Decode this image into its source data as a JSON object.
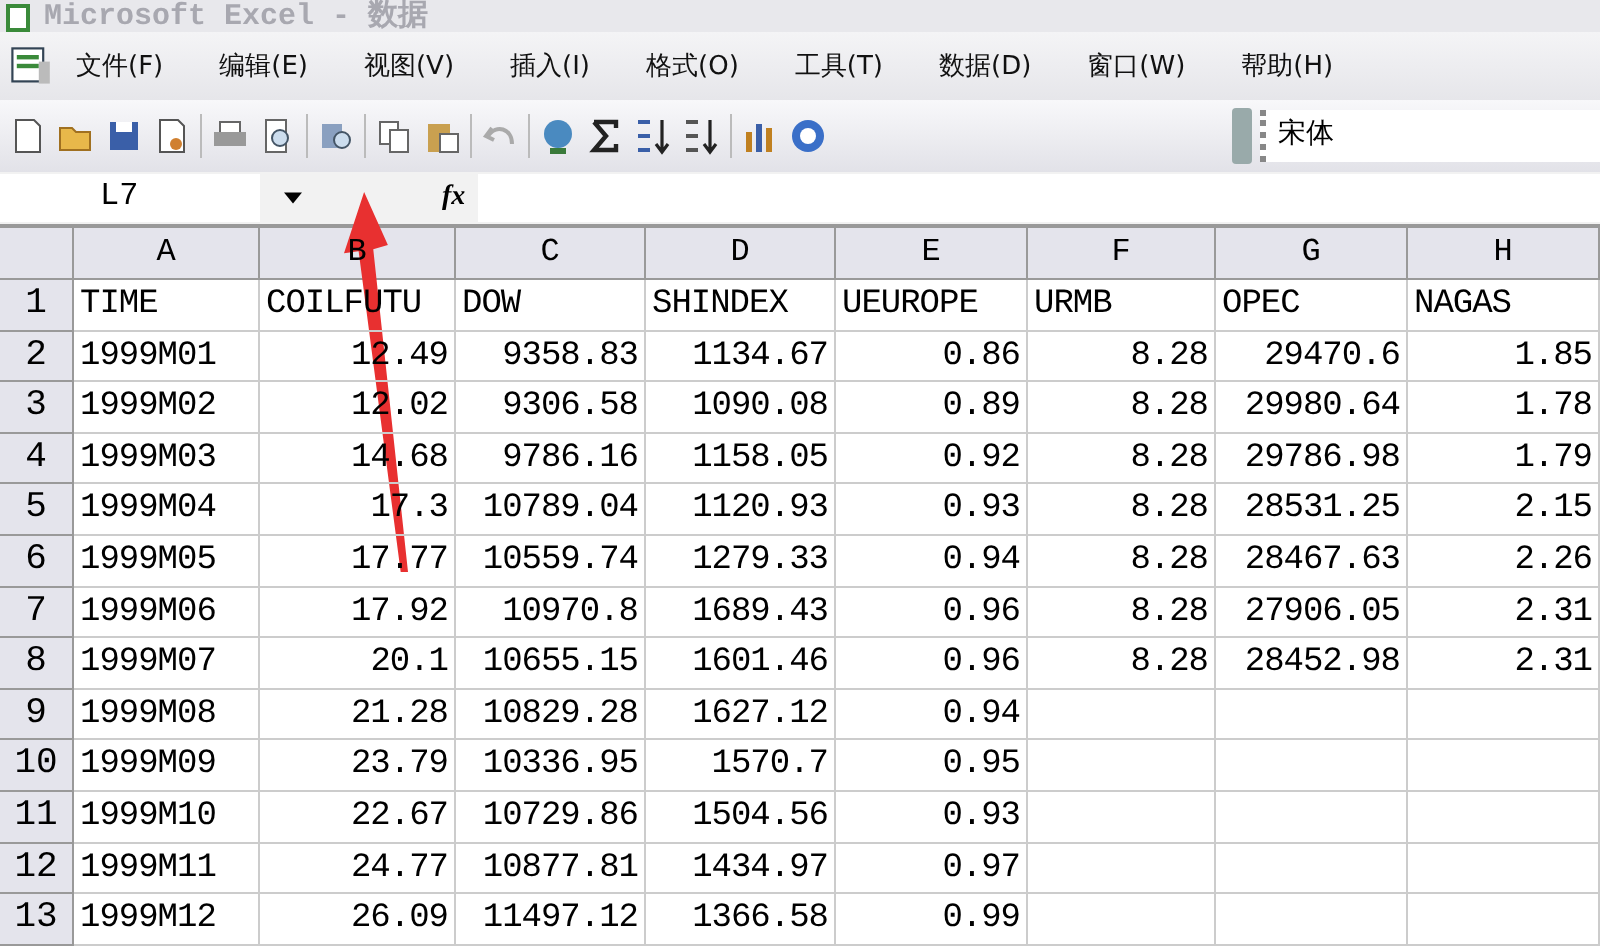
{
  "window": {
    "title": "Microsoft Excel - 数据"
  },
  "menu": [
    "文件(F)",
    "编辑(E)",
    "视图(V)",
    "插入(I)",
    "格式(O)",
    "工具(T)",
    "数据(D)",
    "窗口(W)",
    "帮助(H)"
  ],
  "toolbar": {
    "font": "宋体"
  },
  "formula_bar": {
    "name_box": "L7",
    "function_label": "fx"
  },
  "sheet": {
    "columns": [
      "A",
      "B",
      "C",
      "D",
      "E",
      "F",
      "G",
      "H"
    ],
    "rows": [
      {
        "number": "1",
        "cells": [
          "TIME",
          "COILFUTU",
          "DOW",
          "SHINDEX",
          "UEUROPE",
          "URMB",
          "OPEC",
          "NAGAS"
        ]
      },
      {
        "number": "2",
        "cells": [
          "1999M01",
          "12.49",
          "9358.83",
          "1134.67",
          "0.86",
          "8.28",
          "29470.6",
          "1.85"
        ]
      },
      {
        "number": "3",
        "cells": [
          "1999M02",
          "12.02",
          "9306.58",
          "1090.08",
          "0.89",
          "8.28",
          "29980.64",
          "1.78"
        ]
      },
      {
        "number": "4",
        "cells": [
          "1999M03",
          "14.68",
          "9786.16",
          "1158.05",
          "0.92",
          "8.28",
          "29786.98",
          "1.79"
        ]
      },
      {
        "number": "5",
        "cells": [
          "1999M04",
          "17.3",
          "10789.04",
          "1120.93",
          "0.93",
          "8.28",
          "28531.25",
          "2.15"
        ]
      },
      {
        "number": "6",
        "cells": [
          "1999M05",
          "17.77",
          "10559.74",
          "1279.33",
          "0.94",
          "8.28",
          "28467.63",
          "2.26"
        ]
      },
      {
        "number": "7",
        "cells": [
          "1999M06",
          "17.92",
          "10970.8",
          "1689.43",
          "0.96",
          "8.28",
          "27906.05",
          "2.31"
        ]
      },
      {
        "number": "8",
        "cells": [
          "1999M07",
          "20.1",
          "10655.15",
          "1601.46",
          "0.96",
          "8.28",
          "28452.98",
          "2.31"
        ]
      },
      {
        "number": "9",
        "cells": [
          "1999M08",
          "21.28",
          "10829.28",
          "1627.12",
          "0.94"
        ]
      },
      {
        "number": "10",
        "cells": [
          "1999M09",
          "23.79",
          "10336.95",
          "1570.7",
          "0.95"
        ]
      },
      {
        "number": "11",
        "cells": [
          "1999M10",
          "22.67",
          "10729.86",
          "1504.56",
          "0.93"
        ]
      },
      {
        "number": "12",
        "cells": [
          "1999M11",
          "24.77",
          "10877.81",
          "1434.97",
          "0.97"
        ]
      },
      {
        "number": "13",
        "cells": [
          "1999M12",
          "26.09",
          "11497.12",
          "1366.58",
          "0.99"
        ]
      }
    ]
  }
}
